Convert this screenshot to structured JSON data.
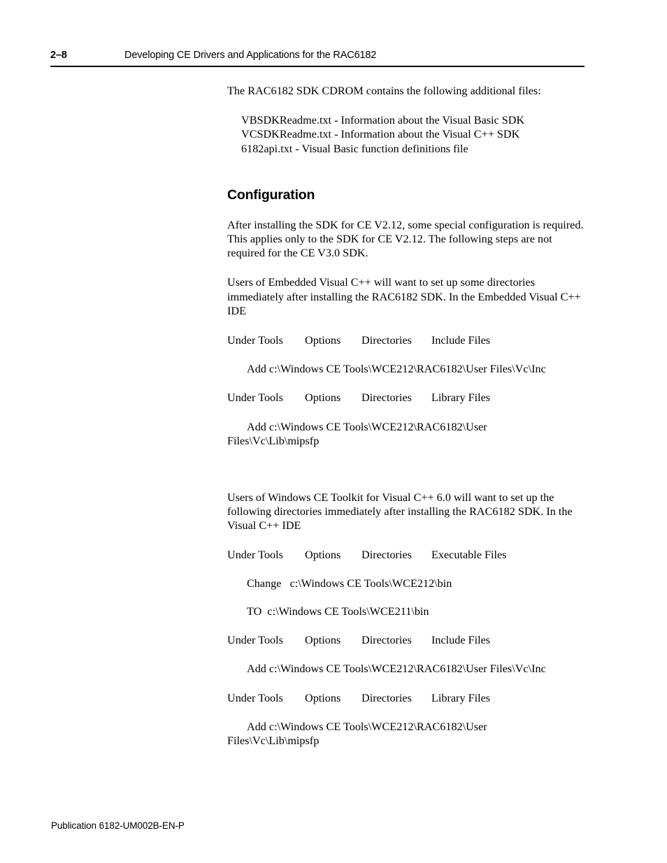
{
  "header": {
    "folio": "2–8",
    "title": "Developing CE Drivers and Applications for the RAC6182"
  },
  "footer": {
    "publication": "Publication 6182-UM002B-EN-P"
  },
  "content": {
    "intro_paragraph": "The RAC6182 SDK CDROM contains the following additional files:",
    "file_list": [
      "VBSDKReadme.txt - Information about the Visual Basic SDK",
      "VCSDKReadme.txt - Information about the Visual C++ SDK",
      "6182api.txt - Visual Basic function definitions file"
    ],
    "section_heading": "Configuration",
    "paragraph_1": "After installing the SDK for CE V2.12, some special configuration is required.  This applies only to the SDK for CE V2.12.  The following steps are not required for the CE V3.0 SDK.",
    "paragraph_2": "Users of Embedded Visual C++ will want to set up some directories immediately after installing the RAC6182 SDK.  In the Embedded Visual C++ IDE",
    "evc_steps": [
      {
        "kind": "tabrow",
        "c0": "Under Tools",
        "c1": "Options",
        "c2": "Directories",
        "c3": "Include Files"
      },
      {
        "kind": "path",
        "text": "Add c:\\Windows CE Tools\\WCE212\\RAC6182\\User Files\\Vc\\Inc"
      },
      {
        "kind": "tabrow",
        "c0": "Under Tools",
        "c1": "Options",
        "c2": "Directories",
        "c3": "Library Files"
      },
      {
        "kind": "path-wrap",
        "line1": "Add c:\\Windows CE Tools\\WCE212\\RAC6182\\User",
        "line2": "Files\\Vc\\Lib\\mipsfp"
      }
    ],
    "paragraph_3": "Users of Windows CE Toolkit for Visual C++ 6.0 will want to set up the following directories immediately after installing the RAC6182 SDK.  In the Visual C++ IDE",
    "vc6_steps": [
      {
        "kind": "tabrow",
        "c0": "Under Tools",
        "c1": "Options",
        "c2": "Directories",
        "c3": "Executable Files"
      },
      {
        "kind": "kv",
        "k": "Change",
        "v": "c:\\Windows CE Tools\\WCE212\\bin"
      },
      {
        "kind": "kv",
        "k": "TO",
        "v": "c:\\Windows CE Tools\\WCE211\\bin"
      },
      {
        "kind": "tabrow",
        "c0": "Under Tools",
        "c1": "Options",
        "c2": "Directories",
        "c3": "Include Files"
      },
      {
        "kind": "path",
        "text": "Add c:\\Windows CE Tools\\WCE212\\RAC6182\\User Files\\Vc\\Inc"
      },
      {
        "kind": "tabrow",
        "c0": "Under Tools",
        "c1": "Options",
        "c2": "Directories",
        "c3": "Library Files"
      },
      {
        "kind": "path-wrap",
        "line1": "Add c:\\Windows CE Tools\\WCE212\\RAC6182\\User",
        "line2": "Files\\Vc\\Lib\\mipsfp"
      }
    ]
  }
}
